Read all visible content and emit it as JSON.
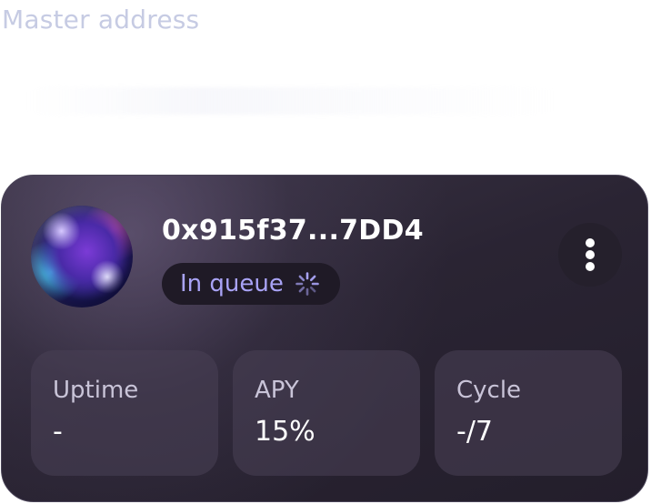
{
  "section": {
    "label": "Master address"
  },
  "node_card": {
    "address": "0x915f37...7DD4",
    "status": {
      "label": "In queue",
      "icon": "spinner-icon",
      "color": "#a9a3f6"
    },
    "menu": {
      "icon": "more-vertical-icon"
    },
    "stats": [
      {
        "label": "Uptime",
        "value": "-"
      },
      {
        "label": "APY",
        "value": "15%"
      },
      {
        "label": "Cycle",
        "value": "-/7"
      }
    ]
  },
  "colors": {
    "card_background": "#2a2433",
    "accent_status_text": "#a9a3f6",
    "section_label": "#c6cbe3"
  }
}
